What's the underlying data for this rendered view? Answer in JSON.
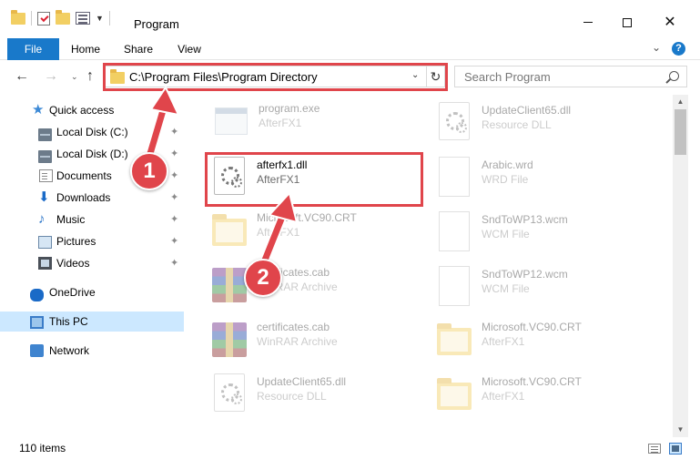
{
  "window": {
    "title": "Program",
    "controls": {
      "minimize": "minimize",
      "maximize": "maximize",
      "close": "✕"
    }
  },
  "ribbon": {
    "tabs": [
      "File",
      "Home",
      "Share",
      "View"
    ],
    "collapse_icon": "chevron-down-icon",
    "help_label": "?"
  },
  "navigation": {
    "back": "←",
    "forward": "→",
    "recent": "⌄",
    "up": "↑",
    "address": "C:\\Program Files\\Program Directory",
    "refresh": "↻",
    "search_placeholder": "Search Program"
  },
  "sidebar": {
    "items": [
      {
        "label": "Quick access",
        "icon": "star-icon",
        "pinned": false
      },
      {
        "label": "Local Disk (C:)",
        "icon": "drive-icon",
        "pinned": true
      },
      {
        "label": "Local Disk (D:)",
        "icon": "drive-icon",
        "pinned": true
      },
      {
        "label": "Documents",
        "icon": "documents-icon",
        "pinned": true
      },
      {
        "label": "Downloads",
        "icon": "download-icon",
        "pinned": true
      },
      {
        "label": "Music",
        "icon": "music-icon",
        "pinned": true
      },
      {
        "label": "Pictures",
        "icon": "pictures-icon",
        "pinned": true
      },
      {
        "label": "Videos",
        "icon": "videos-icon",
        "pinned": true
      },
      {
        "label": "OneDrive",
        "icon": "cloud-icon",
        "pinned": false
      },
      {
        "label": "This PC",
        "icon": "computer-icon",
        "pinned": false,
        "selected": true
      },
      {
        "label": "Network",
        "icon": "network-icon",
        "pinned": false
      }
    ],
    "pin_glyph": "📌"
  },
  "files": {
    "left_column": [
      {
        "name": "program.exe",
        "type": "AfterFX1",
        "icon": "exe-icon",
        "faded": true
      },
      {
        "name": "afterfx1.dll",
        "type": "AfterFX1",
        "icon": "dll-icon",
        "faded": false,
        "highlighted": true
      },
      {
        "name": "Microsoft.VC90.CRT",
        "type": "AfterFX1",
        "icon": "folder-icon",
        "faded": true
      },
      {
        "name": "certificates.cab",
        "type": "WinRAR Archive",
        "icon": "archive-icon",
        "faded": true
      },
      {
        "name": "certificates.cab",
        "type": "WinRAR Archive",
        "icon": "archive-icon",
        "faded": true
      },
      {
        "name": "UpdateClient65.dll",
        "type": "Resource DLL",
        "icon": "dll-icon",
        "faded": true
      }
    ],
    "right_column": [
      {
        "name": "UpdateClient65.dll",
        "type": "Resource DLL",
        "icon": "dll-icon",
        "faded": true
      },
      {
        "name": "Arabic.wrd",
        "type": "WRD File",
        "icon": "document-icon",
        "faded": true
      },
      {
        "name": "SndToWP13.wcm",
        "type": "WCM File",
        "icon": "document-icon",
        "faded": true
      },
      {
        "name": "SndToWP12.wcm",
        "type": "WCM File",
        "icon": "document-icon",
        "faded": true
      },
      {
        "name": "Microsoft.VC90.CRT",
        "type": "AfterFX1",
        "icon": "folder-icon",
        "faded": true
      },
      {
        "name": "Microsoft.VC90.CRT",
        "type": "AfterFX1",
        "icon": "folder-icon",
        "faded": true
      }
    ]
  },
  "status": {
    "item_count": "110 items"
  },
  "annotations": {
    "step1": "1",
    "step2": "2",
    "color": "#e0454b"
  },
  "colors": {
    "accent": "#1979ca",
    "selection": "#cce8ff",
    "annotation": "#e0454b"
  }
}
